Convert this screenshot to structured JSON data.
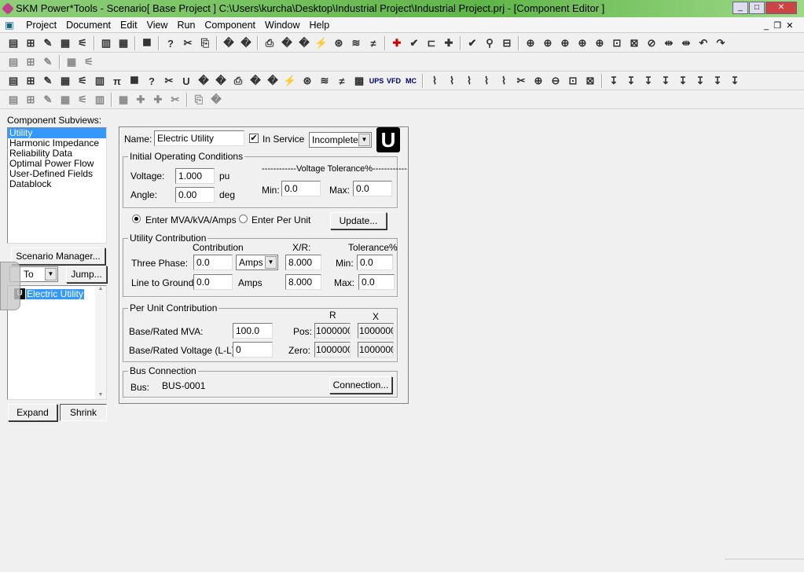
{
  "window": {
    "title": "SKM Power*Tools - Scenario[ Base Project ] C:\\Users\\kurcha\\Desktop\\Industrial Project\\Industrial Project.prj - [Component Editor ]"
  },
  "menu": [
    "Project",
    "Document",
    "Edit",
    "View",
    "Run",
    "Component",
    "Window",
    "Help"
  ],
  "toolbars": [
    [
      "layout-icon",
      "one-line-icon",
      "tcc-icon",
      "report-icon",
      "datablock-icon",
      "|",
      "spreadsheet-icon",
      "save-icon",
      "|",
      "help-pointer-icon",
      "|",
      "cut-icon",
      "copy-icon",
      "paste-icon",
      "|",
      "print-icon",
      "print-preview-icon",
      "|",
      "run-icon",
      "study-icon",
      "harmonics-icon",
      "transient-icon",
      "pattern-icon",
      "light-icon",
      "dc-icon",
      "|",
      "add-icon",
      "check-icon",
      "binoculars-icon",
      "insert-icon",
      "|",
      "tool-icon",
      "truck-icon",
      "scissors-icon",
      "|",
      "zoom-in-icon",
      "zoom-out-icon",
      "zoom-fit-icon",
      "zoom-window-icon",
      "zoom-prev-icon",
      "align-icon",
      "align2-icon",
      "undo-icon",
      "redo-icon",
      "text-icon",
      "diamond-icon",
      "circle-icon"
    ],
    [
      "text-tool-icon",
      "hand-icon",
      "bus-icon",
      "|",
      "ruler-icon",
      "pencil-icon"
    ],
    [
      "load-icon",
      "bus-bar-icon",
      "motor-icon",
      "transformer-icon",
      "transformer3-icon",
      "capacitor-icon",
      "pi-icon",
      "tie-icon",
      "reactor-icon",
      "ground-icon",
      "utility-icon",
      "generator-icon",
      "tree-icon",
      "grid-icon",
      "cube-icon",
      "motor-m-icon",
      "sync-icon",
      "panel-icon",
      "fuse-icon",
      "breaker-icon",
      "monitor-icon",
      "ups-icon",
      "vfd-icon",
      "mc-icon",
      "|",
      "switch1-icon",
      "switch2-icon",
      "switch3-icon",
      "switch4-icon",
      "switch5-icon",
      "relay-icon",
      "ct-icon",
      "node-icon",
      "link-icon",
      "fork-icon",
      "|",
      "arrow1-icon",
      "arrow2-icon",
      "arrow3-icon",
      "arrow4-icon",
      "arrow5-icon",
      "arrow6-icon",
      "arrow7-icon",
      "arrow8-icon"
    ],
    [
      "calendar-icon",
      "chart-icon",
      "clock-icon",
      "pulse-icon",
      "runner-icon",
      "graph-icon",
      "|",
      "flag-icon",
      "plus-icon",
      "plus2-icon",
      "check-down-icon",
      "|",
      "check-up-icon",
      "t-icon"
    ]
  ],
  "subviews": {
    "label": "Component Subviews:",
    "items": [
      "Utility",
      "Harmonic Impedance",
      "Reliability Data",
      "Optimal Power Flow",
      "User-Defined Fields",
      "Datablock"
    ],
    "selected": 0
  },
  "left": {
    "scenario_manager": "Scenario Manager...",
    "goto": "To",
    "jump": "Jump...",
    "tree_item": "Electric Utility",
    "expand": "Expand",
    "shrink": "Shrink"
  },
  "editor": {
    "name_label": "Name:",
    "name": "Electric Utility",
    "in_service_label": "In Service",
    "in_service": true,
    "status": "Incomplete",
    "badge": "U",
    "ioc": {
      "title": "Initial Operating Conditions",
      "voltage_label": "Voltage:",
      "voltage": "1.000",
      "voltage_unit": "pu",
      "angle_label": "Angle:",
      "angle": "0.00",
      "angle_unit": "deg",
      "tol_title": "------------Voltage Tolerance%------------",
      "min_label": "Min:",
      "min": "0.0",
      "max_label": "Max:",
      "max": "0.0"
    },
    "mode": {
      "opt1": "Enter MVA/kVA/Amps",
      "opt2": "Enter Per Unit",
      "selected": "opt1",
      "update": "Update..."
    },
    "uc": {
      "title": "Utility Contribution",
      "contribution": "Contribution",
      "xr": "X/R:",
      "tolerance": "Tolerance%",
      "three_phase_label": "Three Phase:",
      "three_phase": "0.0",
      "three_phase_unit": "Amps",
      "three_phase_xr": "8.000",
      "min_label": "Min:",
      "min": "0.0",
      "lg_label": "Line to Ground:",
      "lg": "0.0",
      "lg_unit": "Amps",
      "lg_xr": "8.000",
      "max_label": "Max:",
      "max": "0.0"
    },
    "pu": {
      "title": "Per Unit Contribution",
      "r": "R",
      "x": "X",
      "mva_label": "Base/Rated MVA:",
      "mva": "100.0",
      "kv_label": "Base/Rated Voltage (L-L):",
      "kv": "0",
      "pos_label": "Pos:",
      "pos_r": "1000000",
      "pos_x": "1000000",
      "zero_label": "Zero:",
      "zero_r": "1000000",
      "zero_x": "1000000"
    },
    "bus": {
      "title": "Bus Connection",
      "label": "Bus:",
      "value": "BUS-0001",
      "connection": "Connection..."
    }
  }
}
